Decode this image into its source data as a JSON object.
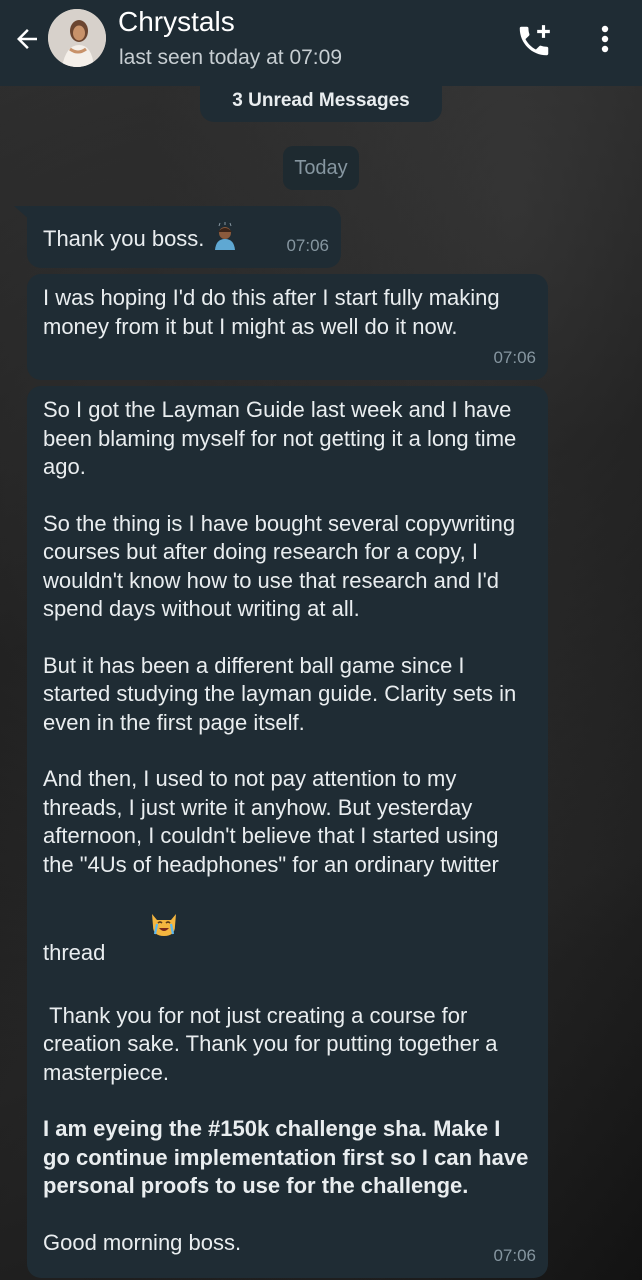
{
  "header": {
    "contact_name": "Chrystals",
    "status": "last seen today at 07:09"
  },
  "banner": {
    "unread": "3 Unread Messages",
    "date": "Today"
  },
  "messages": [
    {
      "paragraphs": [
        "Thank you boss."
      ],
      "time": "07:06"
    },
    {
      "paragraphs": [
        "I was hoping I'd do this after I start fully making money from it but I might as well do it now."
      ],
      "time": "07:06"
    },
    {
      "paragraphs": [
        "So I got the Layman Guide last week and I have been blaming myself for not getting it a long time ago.",
        "So the thing is I have bought several copywriting courses but after doing research for a copy, I wouldn't know how to use that research and I'd spend days without writing at all.",
        "But it has been a different ball game since I started studying the layman guide. Clarity sets in even in the first page itself.",
        "And then, I used to not pay attention to my threads, I just write it anyhow. But yesterday afternoon, I couldn't believe that I started using the \"4Us of headphones\" for an ordinary twitter thread",
        " Thank you for not just creating a course for creation sake. Thank you for putting together a masterpiece.",
        "I am eyeing the #150k challenge sha. Make I go continue implementation first so I can have personal proofs to use for the challenge.",
        "Good morning boss."
      ],
      "time": "07:06"
    }
  ],
  "icons": {
    "back": "back-arrow-icon",
    "call": "add-call-icon",
    "menu": "more-vert-icon",
    "emoji_1": "person-bowing-emoji",
    "emoji_2": "crying-cat-emoji"
  },
  "colors": {
    "header_bg": "#1f2c34",
    "bubble_bg": "#1f2c34",
    "text": "#e9edef",
    "meta": "#8696a0"
  }
}
